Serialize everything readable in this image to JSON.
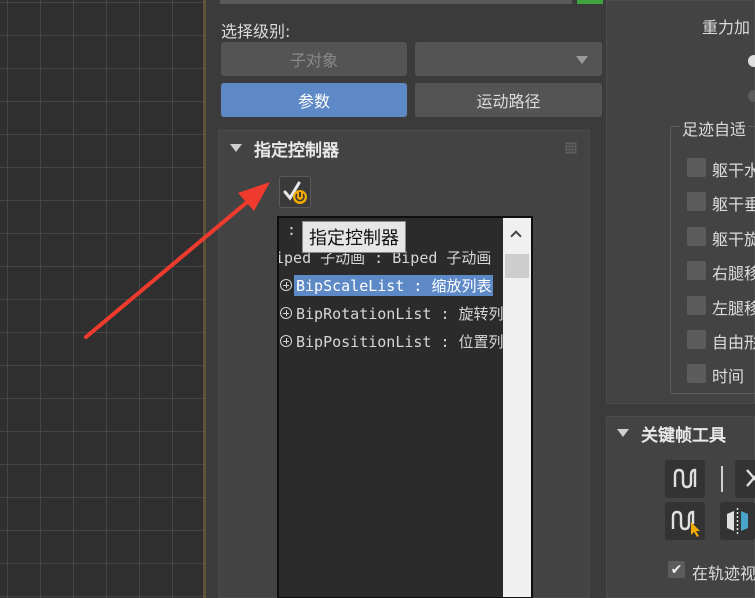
{
  "command_panel": {
    "selection_level_label": "选择级别:",
    "sub_object_button": "子对象",
    "params_button": "参数",
    "motion_paths_button": "运动路径"
  },
  "assign_controller": {
    "rollout_title": "指定控制器",
    "tooltip": "指定控制器",
    "tree": {
      "rows": [
        ": ",
        "iped 子动画 : Biped 子动画",
        "BipScaleList : 缩放列表",
        "BipRotationList : 旋转列表",
        "BipPositionList : 位置列表"
      ],
      "selected_index": 2
    }
  },
  "right_panel": {
    "gravity_label": "重力加",
    "footstep_group_title": "足迹自适",
    "checkbox_labels": [
      "躯干水",
      "躯干垂",
      "躯干旋",
      "右腿移",
      "左腿移",
      "自由形",
      "时间"
    ],
    "keyframe_tools_title": "关键帧工具",
    "track_label": "在轨迹视"
  },
  "colors": {
    "accent": "#5d8ac7",
    "arrow": "#ee3b2e",
    "status_green": "#3fa33f"
  }
}
